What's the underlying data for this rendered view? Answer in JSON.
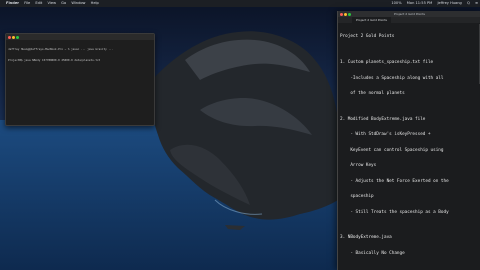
{
  "menubar": {
    "apple": "",
    "app_name": "Finder",
    "menus": [
      "File",
      "Edit",
      "View",
      "Go",
      "Window",
      "Help"
    ],
    "right_items": [
      "100%",
      "Mon 11:55 PM",
      "Jeffrey Huang",
      "Q",
      "≡"
    ]
  },
  "terminal": {
    "lines": [
      "Jeffrey Huang@Jeffreys-MacBook-Pro ~ % javac ... java Gravity ...",
      "ProjectB$ java NBody 157788000.0 25000.0 data/planets.txt"
    ]
  },
  "editor": {
    "title": "Project 2 Gold Points",
    "tab_label": "Project 2 Gold Points",
    "lines": [
      "Project 2 Gold Points",
      "",
      "1. Custom planets_spaceship.txt file",
      "    -Includes a Spaceship along with all",
      "    of the normal planets",
      "",
      "2. Modified BodyExtreme.java file",
      "    - With StdDraw's isKeyPressed +",
      "    KeyEvent can control Spaceship using",
      "    Arrow Keys",
      "    - Adjusts the Net Force Exerted on the",
      "    spaceship",
      "    - Still Treats the spaceship as a Body",
      "",
      "3. NBodyExtreme.java",
      "    - Basically No Change"
    ]
  }
}
